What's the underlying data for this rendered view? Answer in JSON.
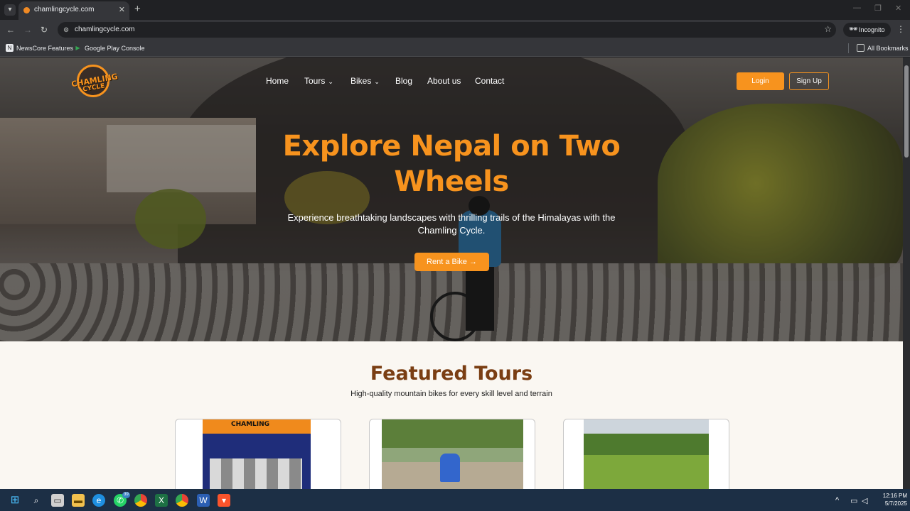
{
  "browser": {
    "tab_title": "chamlingcycle.com",
    "tab_close": "✕",
    "new_tab": "+",
    "url": "chamlingcycle.com",
    "incognito_label": "Incognito",
    "bookmarks": [
      {
        "label": "NewsCore Features"
      },
      {
        "label": "Google Play Console"
      }
    ],
    "all_bookmarks": "All Bookmarks"
  },
  "site": {
    "logo": {
      "line1": "CHAMLING",
      "line2": "CYCLE"
    },
    "nav": {
      "home": "Home",
      "tours": "Tours",
      "bikes": "Bikes",
      "blog": "Blog",
      "about": "About us",
      "contact": "Contact"
    },
    "login": "Login",
    "signup": "Sign Up",
    "hero": {
      "title": "Explore Nepal on Two Wheels",
      "subtitle": "Experience breathtaking landscapes with thrilling trails of the Himalayas with the Chamling Cycle.",
      "cta": "Rent a Bike →"
    },
    "featured": {
      "title": "Featured Tours",
      "subtitle": "High-quality mountain bikes for every skill level and terrain",
      "card1_sign": "CHAMLING"
    }
  },
  "taskbar": {
    "whatsapp_badge": "39",
    "time": "12:16 PM",
    "date": "5/7/2025"
  },
  "colors": {
    "brand_orange": "#f7931e",
    "section_title": "#7a3e13",
    "page_bg": "#faf7f2",
    "taskbar_bg": "#1c2f45"
  }
}
